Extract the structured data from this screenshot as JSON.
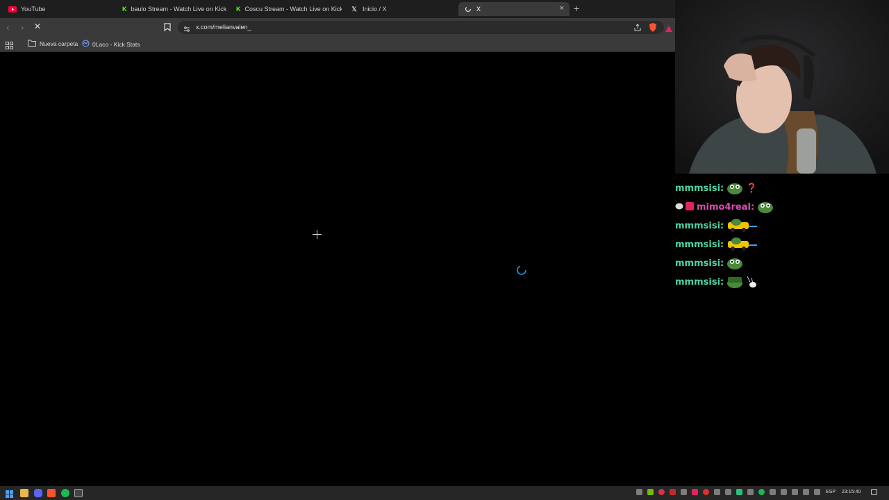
{
  "browser": {
    "tabs": [
      {
        "label": "YouTube",
        "icon": "youtube-icon",
        "color": "#ff0033"
      },
      {
        "label": "baulo Stream - Watch Live on Kick",
        "icon": "kick-icon",
        "color": "#53fc18"
      },
      {
        "label": "Coscu Stream - Watch Live on Kick",
        "icon": "kick-icon",
        "color": "#53fc18"
      },
      {
        "label": "Inicio / X",
        "icon": "x-icon",
        "color": "#ffffff"
      },
      {
        "label": "X",
        "icon": "loading-icon",
        "color": "#ffffff"
      }
    ],
    "new_tab_symbol": "+",
    "close_symbol": "×",
    "url": "x.com/melianvalen_",
    "bookmarks": [
      {
        "label": "Nueva carpeta",
        "icon": "folder-icon"
      },
      {
        "label": "0Laco - Kick Stats",
        "icon": "kickstats-icon"
      }
    ]
  },
  "chat": {
    "messages": [
      {
        "user": "mmmsisi:",
        "emotes": [
          "pepe",
          "question"
        ]
      },
      {
        "user": "mimo4real:",
        "emotes": [
          "pepe"
        ],
        "badges": true
      },
      {
        "user": "mmmsisi:",
        "emotes": [
          "pepe-car"
        ]
      },
      {
        "user": "mmmsisi:",
        "emotes": [
          "pepe-car"
        ]
      },
      {
        "user": "mmmsisi:",
        "emotes": [
          "pepe"
        ]
      },
      {
        "user": "mmmsisi:",
        "emotes": [
          "pepe-hat",
          "sparkle"
        ]
      }
    ],
    "username_color": "#4fd2a4",
    "highlight_color": "#d84fae"
  },
  "taskbar": {
    "language": "ESP",
    "time": "23:15:40"
  }
}
